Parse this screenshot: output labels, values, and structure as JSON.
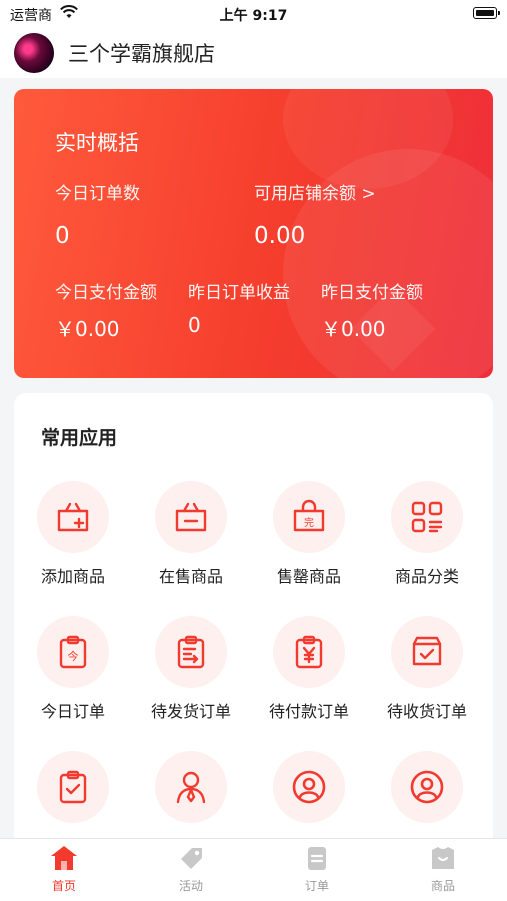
{
  "status_bar": {
    "carrier": "运营商",
    "time": "上午 9:17"
  },
  "header": {
    "shop_name": "三个学霸旗舰店"
  },
  "overview": {
    "title": "实时概括",
    "today_orders_label": "今日订单数",
    "today_orders_value": "0",
    "balance_label": "可用店铺余额 >",
    "balance_value": "0.00",
    "today_paid_label": "今日支付金额",
    "today_paid_value": "￥0.00",
    "yesterday_income_label": "昨日订单收益",
    "yesterday_income_value": "0",
    "yesterday_paid_label": "昨日支付金额",
    "yesterday_paid_value": "￥0.00"
  },
  "apps": {
    "title": "常用应用",
    "items": [
      {
        "label": "添加商品",
        "icon": "bag-plus-icon"
      },
      {
        "label": "在售商品",
        "icon": "bag-minus-icon"
      },
      {
        "label": "售罄商品",
        "icon": "bag-soldout-icon"
      },
      {
        "label": "商品分类",
        "icon": "category-icon"
      },
      {
        "label": "今日订单",
        "icon": "clipboard-today-icon"
      },
      {
        "label": "待发货订单",
        "icon": "clipboard-ship-icon"
      },
      {
        "label": "待付款订单",
        "icon": "clipboard-yen-icon"
      },
      {
        "label": "待收货订单",
        "icon": "box-check-icon"
      },
      {
        "label": "",
        "icon": "clipboard-check-icon"
      },
      {
        "label": "",
        "icon": "customer-icon"
      },
      {
        "label": "",
        "icon": "user-circle-icon"
      },
      {
        "label": "",
        "icon": "user-circle-icon"
      }
    ]
  },
  "tabbar": {
    "items": [
      {
        "label": "首页",
        "icon": "home-icon",
        "active": true
      },
      {
        "label": "活动",
        "icon": "tag-icon",
        "active": false
      },
      {
        "label": "订单",
        "icon": "order-icon",
        "active": false
      },
      {
        "label": "商品",
        "icon": "goods-icon",
        "active": false
      }
    ]
  },
  "colors": {
    "accent": "#f23a2e",
    "card_gradient_start": "#ff5a3c",
    "card_gradient_end": "#ee2f3b",
    "icon_bg": "#fdf0ef"
  }
}
